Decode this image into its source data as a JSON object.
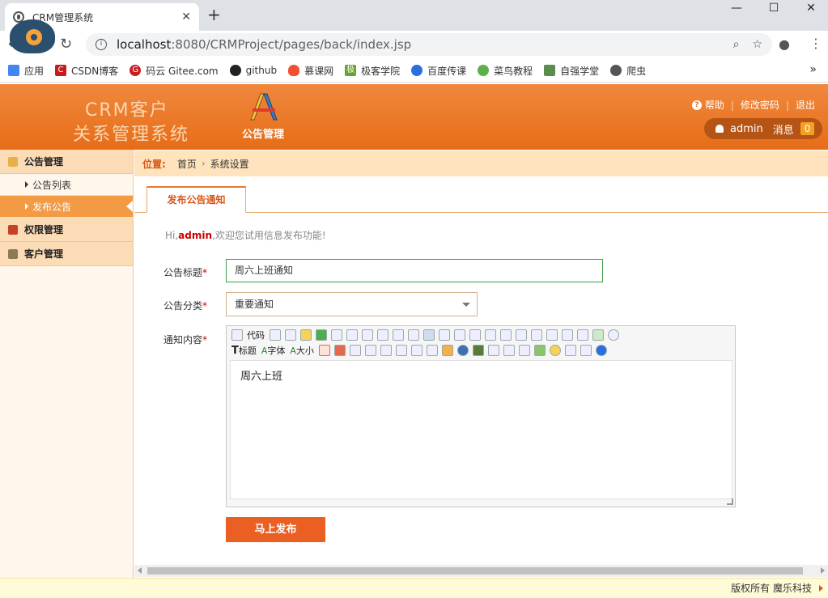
{
  "browser": {
    "tab_title": "CRM管理系统",
    "url_host": "localhost",
    "url_rest": ":8080/CRMProject/pages/back/index.jsp",
    "bookmarks": [
      {
        "label": "应用",
        "color": "#4285f4"
      },
      {
        "label": "CSDN博客",
        "color": "#c61c1c"
      },
      {
        "label": "码云 Gitee.com",
        "color": "#c71d23"
      },
      {
        "label": "github",
        "color": "#222222"
      },
      {
        "label": "慕课网",
        "color": "#f05030"
      },
      {
        "label": "极客学院",
        "color": "#66a22e"
      },
      {
        "label": "百度传课",
        "color": "#2a6ee0"
      },
      {
        "label": "菜鸟教程",
        "color": "#5db04a"
      },
      {
        "label": "自强学堂",
        "color": "#5a8d4c"
      },
      {
        "label": "爬虫",
        "color": "#555555"
      }
    ]
  },
  "header": {
    "brand_line1": "CRM客户",
    "brand_line2": "关系管理系统",
    "module_label": "公告管理",
    "links": {
      "help": "帮助",
      "change_password": "修改密码",
      "logout": "退出"
    },
    "user": "admin",
    "messages_label": "消息",
    "messages_count": "0"
  },
  "sidebar": {
    "groups": [
      {
        "label": "公告管理",
        "items": [
          {
            "label": "公告列表"
          },
          {
            "label": "发布公告"
          }
        ]
      },
      {
        "label": "权限管理"
      },
      {
        "label": "客户管理"
      }
    ]
  },
  "breadcrumb": {
    "label": "位置:",
    "home": "首页",
    "current": "系统设置"
  },
  "form": {
    "tab_label": "发布公告通知",
    "greeting_pre": "Hi,",
    "greeting_user": "admin",
    "greeting_post": ",欢迎您试用信息发布功能!",
    "title_label": "公告标题",
    "title_value": "周六上班通知",
    "category_label": "公告分类",
    "category_value": "重要通知",
    "content_label": "通知内容",
    "required_mark": "*",
    "editor": {
      "btn_code": "代码",
      "btn_heading": "标题",
      "btn_font": "字体",
      "btn_size": "大小",
      "content": "周六上班"
    },
    "submit_label": "马上发布"
  },
  "footer": {
    "text": "版权所有 魔乐科技"
  },
  "colors": {
    "accent": "#e66d18",
    "active_item": "#f39a44",
    "button": "#ea5f22"
  }
}
